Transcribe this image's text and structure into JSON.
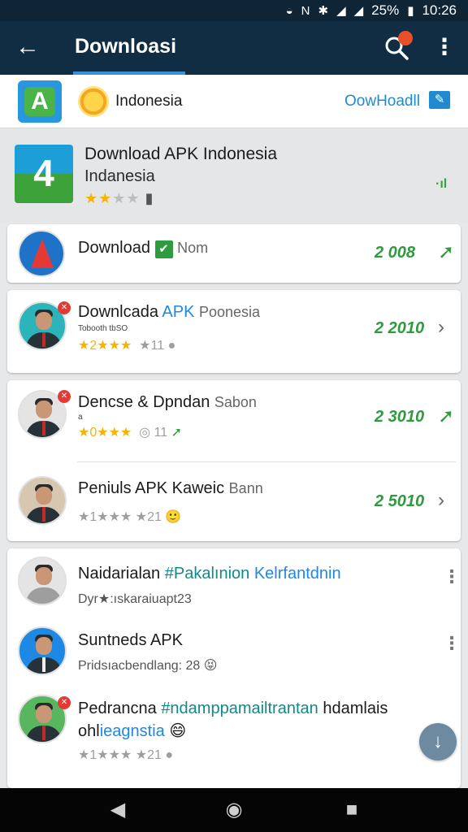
{
  "status_bar": {
    "battery": "25%",
    "time": "10:26"
  },
  "app_bar": {
    "title": "Downloasi"
  },
  "top_strip": {
    "country": "Indonesia",
    "download_link": "OowHoadll"
  },
  "featured": {
    "title": "Download APK Indonesia",
    "subtitle": "Indanesia",
    "rating_stars": "★★★★",
    "signal": "·ıl"
  },
  "list": [
    {
      "title": "Download",
      "chip": "✔",
      "extra": "Nom",
      "right": "2 008",
      "arrow": "➚"
    },
    {
      "title": "Downlcada",
      "title_acc": "APK",
      "title_muted": "Poonesia",
      "sub": "Tobooth tbSO",
      "meta_gold": "★2★★★",
      "meta_grey": "★11",
      "right": "2 2010",
      "arrow": "›"
    },
    {
      "title": "Dencse & Dpndan",
      "title_muted": "Sabon",
      "sub": "a",
      "meta_gold": "★0★★★",
      "meta_grey": "◎ 11",
      "right": "2 3010",
      "arrow": "➚"
    },
    {
      "title": "Peniuls APK Kaweic",
      "title_muted": "Bann",
      "meta_grey": "★1★★★ ★21",
      "emoji": "🙂",
      "right": "2 5010",
      "arrow": "›"
    }
  ],
  "list2": [
    {
      "title": "Naidarialan",
      "title_acc": "#Pakalınion",
      "title_acc2": "Kelrfantdnin",
      "meta": "Dyr★:ıskaraiuapt23"
    },
    {
      "title": "Suntneds APK",
      "meta": "Pridsıacbendlang: 28"
    },
    {
      "title": "Pedrancna",
      "title_acc": "#ndamppamailtrantan",
      "title2": "hdamlais",
      "line2": "ohl",
      "line2_acc": "ieagnstia",
      "meta": "★1★★★ ★21"
    }
  ]
}
